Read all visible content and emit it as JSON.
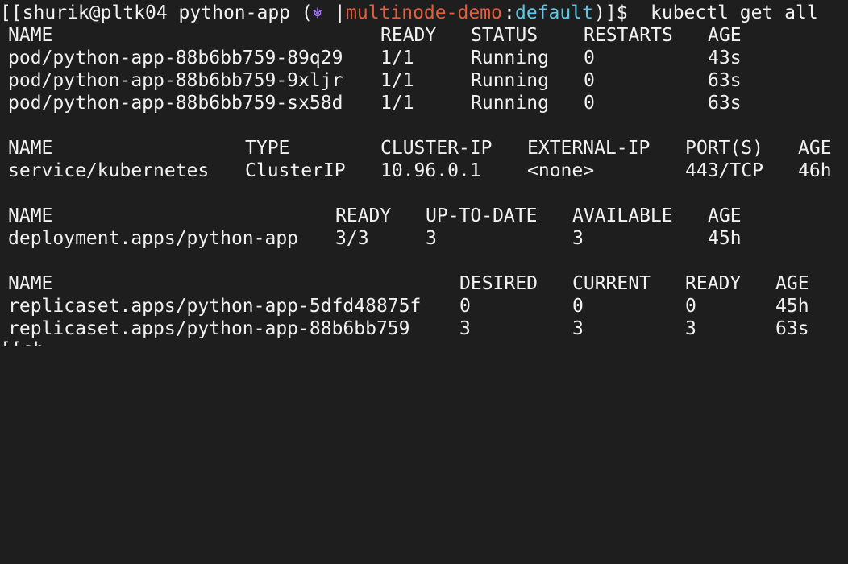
{
  "colors": {
    "background": "#1e1e1e",
    "foreground": "#f2f2f2",
    "k8s_icon": "#a678ff",
    "context": "#e35d3d",
    "namespace": "#5fc7e6",
    "cursor": "#9a9a9a"
  },
  "prompt": {
    "user_host_dir": "[[shurik@pltk04 python-app (",
    "k8s_icon": "⎈",
    "separator": " |",
    "context": "multinode-demo",
    "colon": ":",
    "namespace": "default",
    "close": ")]$ ",
    "command": "kubectl get all"
  },
  "pods": {
    "headers": [
      "NAME",
      "READY",
      "STATUS",
      "RESTARTS",
      "AGE"
    ],
    "rows": [
      [
        "pod/python-app-88b6bb759-89q29",
        "1/1",
        "Running",
        "0",
        "43s"
      ],
      [
        "pod/python-app-88b6bb759-9xljr",
        "1/1",
        "Running",
        "0",
        "63s"
      ],
      [
        "pod/python-app-88b6bb759-sx58d",
        "1/1",
        "Running",
        "0",
        "63s"
      ]
    ]
  },
  "services": {
    "headers": [
      "NAME",
      "TYPE",
      "CLUSTER-IP",
      "EXTERNAL-IP",
      "PORT(S)",
      "AGE"
    ],
    "rows": [
      [
        "service/kubernetes",
        "ClusterIP",
        "10.96.0.1",
        "<none>",
        "443/TCP",
        "46h"
      ]
    ]
  },
  "deployments": {
    "headers": [
      "NAME",
      "READY",
      "UP-TO-DATE",
      "AVAILABLE",
      "AGE"
    ],
    "rows": [
      [
        "deployment.apps/python-app",
        "3/3",
        "3",
        "3",
        "45h"
      ]
    ]
  },
  "replicasets": {
    "headers": [
      "NAME",
      "DESIRED",
      "CURRENT",
      "READY",
      "AGE"
    ],
    "rows": [
      [
        "replicaset.apps/python-app-5dfd48875f",
        "0",
        "0",
        "0",
        "45h"
      ],
      [
        "replicaset.apps/python-app-88b6bb759",
        "3",
        "3",
        "3",
        "63s"
      ]
    ]
  }
}
